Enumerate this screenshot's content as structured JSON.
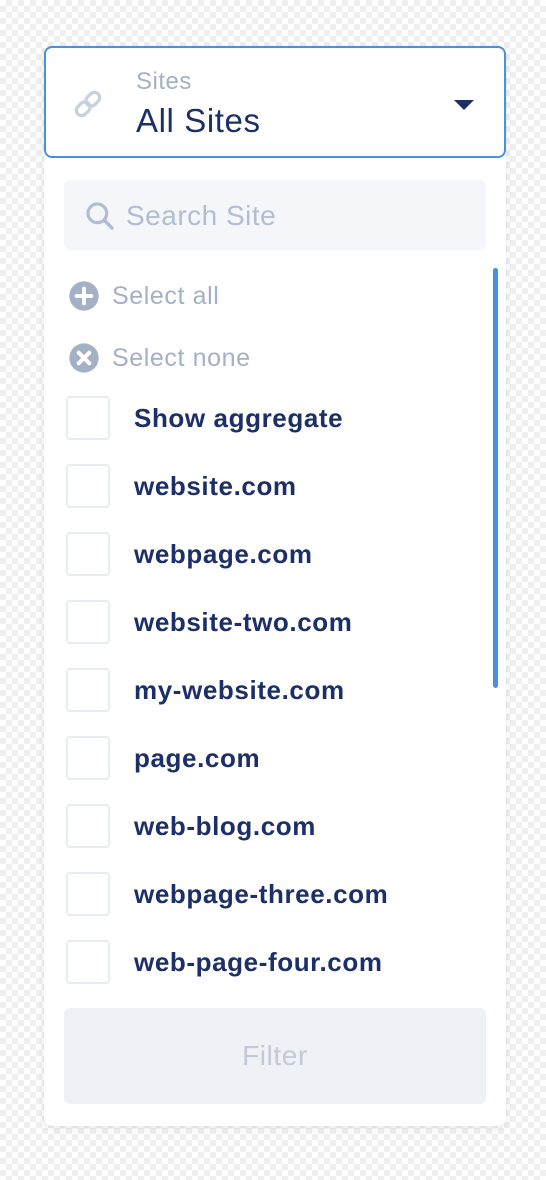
{
  "dropdown": {
    "field_label": "Sites",
    "selected_value": "All Sites",
    "icon": "link-icon",
    "caret_icon": "caret-down-icon"
  },
  "search": {
    "placeholder": "Search Site",
    "value": "",
    "icon": "search-icon"
  },
  "actions": {
    "select_all": "Select all",
    "select_none": "Select none"
  },
  "options": [
    {
      "label": "Show aggregate",
      "checked": false
    },
    {
      "label": "website.com",
      "checked": false
    },
    {
      "label": "webpage.com",
      "checked": false
    },
    {
      "label": "website-two.com",
      "checked": false
    },
    {
      "label": "my-website.com",
      "checked": false
    },
    {
      "label": "page.com",
      "checked": false
    },
    {
      "label": "web-blog.com",
      "checked": false
    },
    {
      "label": "webpage-three.com",
      "checked": false
    },
    {
      "label": "web-page-four.com",
      "checked": false
    }
  ],
  "filter_button": {
    "label": "Filter",
    "disabled": true
  },
  "colors": {
    "accent": "#4a90e2",
    "text_primary": "#1c2f66",
    "text_muted": "#a4b0c6",
    "icon_muted": "#a4b0c6"
  }
}
